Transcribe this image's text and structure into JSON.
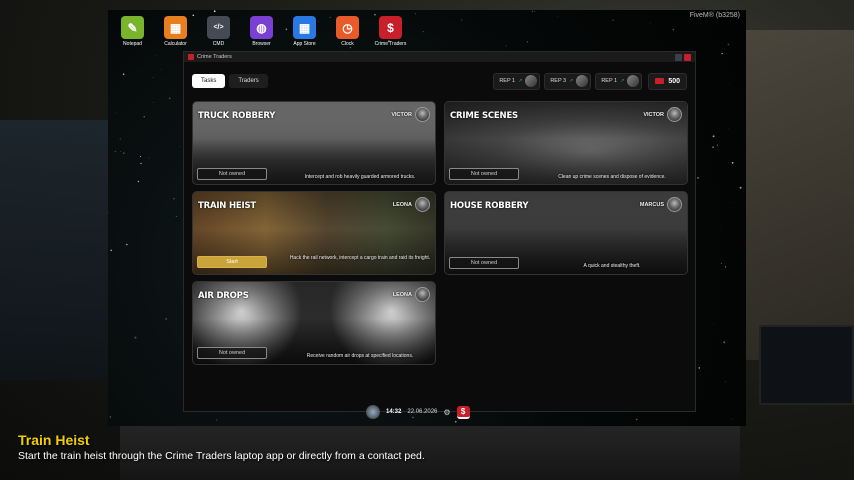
{
  "taskbar_apps": [
    {
      "label": "Notepad",
      "icon": "notepad-icon",
      "color": "#7ab32c"
    },
    {
      "label": "Calculator",
      "icon": "calculator-icon",
      "color": "#e87e1e"
    },
    {
      "label": "CMD",
      "icon": "terminal-icon",
      "color": "#444b55"
    },
    {
      "label": "Browser",
      "icon": "globe-icon",
      "color": "#7b3fd4"
    },
    {
      "label": "App Store",
      "icon": "grid-icon",
      "color": "#2a78e4"
    },
    {
      "label": "Clock",
      "icon": "clock-icon",
      "color": "#e85a2a"
    },
    {
      "label": "Crime Traders",
      "icon": "dollar-icon",
      "color": "#c8202a"
    }
  ],
  "status_right": "FiveM® (b3258)",
  "window": {
    "title": "Crime Traders"
  },
  "tabs": [
    {
      "label": "Tasks",
      "active": true
    },
    {
      "label": "Traders",
      "active": false
    }
  ],
  "reputation": [
    {
      "label": "REP 1"
    },
    {
      "label": "REP 3"
    },
    {
      "label": "REP 1"
    }
  ],
  "money": "500",
  "tasks": [
    {
      "title": "TRUCK ROBBERY",
      "contact": "VICTOR",
      "description": "Intercept and rob heavily guarded armored trucks.",
      "action": "Not owned",
      "action_state": "disabled"
    },
    {
      "title": "CRIME SCENES",
      "contact": "VICTOR",
      "description": "Clean up crime scenes and dispose of evidence.",
      "action": "Not owned",
      "action_state": "disabled"
    },
    {
      "title": "TRAIN HEIST",
      "contact": "LEONA",
      "description": "Hack the rail network, intercept a cargo train and raid its freight.",
      "action": "Start",
      "action_state": "start"
    },
    {
      "title": "HOUSE ROBBERY",
      "contact": "MARCUS",
      "description": "A quick and stealthy theft.",
      "action": "Not owned",
      "action_state": "disabled"
    },
    {
      "title": "AIR DROPS",
      "contact": "LEONA",
      "description": "Receive random air drops at specified locations.",
      "action": "Not owned",
      "action_state": "disabled"
    }
  ],
  "clock": {
    "time": "14:32",
    "date": "22.06.2026"
  },
  "caption": {
    "title": "Train Heist",
    "subtitle": "Start the train heist through the Crime Traders laptop app or directly from a contact ped."
  }
}
